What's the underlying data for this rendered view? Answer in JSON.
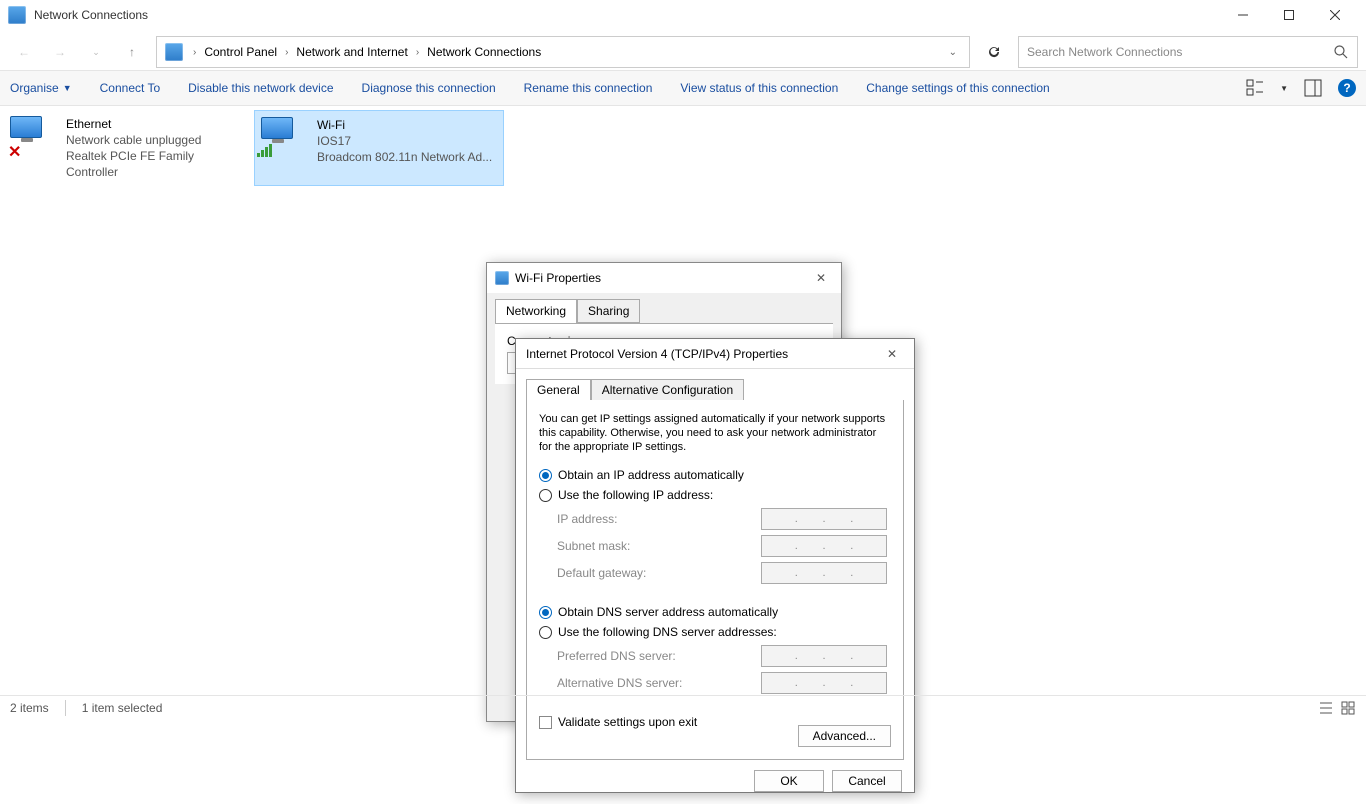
{
  "window": {
    "title": "Network Connections"
  },
  "breadcrumb": {
    "items": [
      "Control Panel",
      "Network and Internet",
      "Network Connections"
    ]
  },
  "search": {
    "placeholder": "Search Network Connections"
  },
  "commands": [
    "Organise",
    "Connect To",
    "Disable this network device",
    "Diagnose this connection",
    "Rename this connection",
    "View status of this connection",
    "Change settings of this connection"
  ],
  "adapters": [
    {
      "name": "Ethernet",
      "status": "Network cable unplugged",
      "device": "Realtek PCIe FE Family Controller",
      "selected": false,
      "error": true
    },
    {
      "name": "Wi-Fi",
      "status": "IOS17",
      "device": "Broadcom 802.11n Network Ad...",
      "selected": true,
      "error": false
    }
  ],
  "statusbar": {
    "items": "2 items",
    "selected": "1 item selected"
  },
  "wifi_dialog": {
    "title": "Wi-Fi Properties",
    "tabs": [
      "Networking",
      "Sharing"
    ],
    "connect_using_label": "Connect using:"
  },
  "ipv4_dialog": {
    "title": "Internet Protocol Version 4 (TCP/IPv4) Properties",
    "tabs": [
      "General",
      "Alternative Configuration"
    ],
    "description": "You can get IP settings assigned automatically if your network supports this capability. Otherwise, you need to ask your network administrator for the appropriate IP settings.",
    "radio_ip_auto": "Obtain an IP address automatically",
    "radio_ip_manual": "Use the following IP address:",
    "ip_address": "IP address:",
    "subnet_mask": "Subnet mask:",
    "default_gateway": "Default gateway:",
    "radio_dns_auto": "Obtain DNS server address automatically",
    "radio_dns_manual": "Use the following DNS server addresses:",
    "preferred_dns": "Preferred DNS server:",
    "alternative_dns": "Alternative DNS server:",
    "validate": "Validate settings upon exit",
    "advanced": "Advanced...",
    "ok": "OK",
    "cancel": "Cancel"
  }
}
